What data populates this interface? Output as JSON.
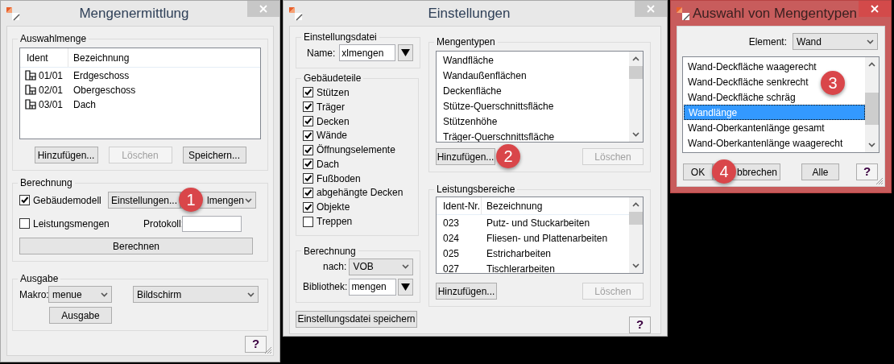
{
  "mengenermittlung": {
    "title": "Mengenermittlung",
    "active": false,
    "auswahlmenge": {
      "label": "Auswahlmenge",
      "columns": [
        "Ident",
        "Bezeichnung"
      ],
      "rows": [
        {
          "ident": "01/01",
          "name": "Erdgeschoss"
        },
        {
          "ident": "02/01",
          "name": "Obergeschoss"
        },
        {
          "ident": "03/01",
          "name": "Dach"
        }
      ],
      "buttons": [
        {
          "label": "Hinzufügen...",
          "disabled": false
        },
        {
          "label": "Löschen",
          "disabled": true
        },
        {
          "label": "Speichern...",
          "disabled": false
        }
      ]
    },
    "berechnung": {
      "label": "Berechnung",
      "checkboxes": [
        {
          "label": "Gebäudemodell",
          "checked": true
        },
        {
          "label": "Leistungsmengen",
          "checked": false
        }
      ],
      "settings_button": "Einstellungen...",
      "settings_select": "lmengen",
      "badge": "1",
      "protokoll_label": "Protokoll:",
      "compute_button": "Berechnen"
    },
    "ausgabe": {
      "label": "Ausgabe",
      "makro_label": "Makro:",
      "makro_select": "menue",
      "target_select": "Bildschirm",
      "button": "Ausgabe"
    },
    "help_button": "?"
  },
  "einstellungen": {
    "title": "Einstellungen",
    "active": false,
    "datei": {
      "label": "Einstellungsdatei",
      "name_label": "Name:",
      "name_value": "xlmengen"
    },
    "gebaeudeteile": {
      "label": "Gebäudeteile",
      "items": [
        {
          "label": "Stützen",
          "checked": true
        },
        {
          "label": "Träger",
          "checked": true
        },
        {
          "label": "Decken",
          "checked": true
        },
        {
          "label": "Wände",
          "checked": true
        },
        {
          "label": "Öffnungselemente",
          "checked": true
        },
        {
          "label": "Dach",
          "checked": true
        },
        {
          "label": "Fußboden",
          "checked": true
        },
        {
          "label": "abgehängte Decken",
          "checked": true
        },
        {
          "label": "Objekte",
          "checked": true
        },
        {
          "label": "Treppen",
          "checked": false
        }
      ]
    },
    "berechnung": {
      "label": "Berechnung",
      "nach_label": "nach:",
      "nach_value": "VOB",
      "bibliothek_label": "Bibliothek:",
      "bibliothek_value": "mengen"
    },
    "save_button": "Einstellungsdatei speichern",
    "mengentypen": {
      "label": "Mengentypen",
      "items": [
        "Wandfläche",
        "Wandaußenflächen",
        "Deckenfläche",
        "Stütze-Querschnittsfläche",
        "Stützenhöhe",
        "Träger-Querschnittsfläche"
      ],
      "buttons": [
        {
          "label": "Hinzufügen...",
          "disabled": false
        },
        {
          "label": "Löschen",
          "disabled": true
        }
      ],
      "badge": "2"
    },
    "leistungsbereiche": {
      "label": "Leistungsbereiche",
      "columns": [
        "Ident-Nr.",
        "Bezeichnung"
      ],
      "rows": [
        {
          "ident": "023",
          "name": "Putz- und Stuckarbeiten"
        },
        {
          "ident": "024",
          "name": "Fliesen- und Plattenarbeiten"
        },
        {
          "ident": "025",
          "name": "Estricharbeiten"
        },
        {
          "ident": "027",
          "name": "Tischlerarbeiten"
        }
      ],
      "buttons": [
        {
          "label": "Hinzufügen...",
          "disabled": false
        },
        {
          "label": "Löschen",
          "disabled": true
        }
      ]
    },
    "help_button": "?"
  },
  "auswahl": {
    "title": "Auswahl von Mengentypen",
    "active": true,
    "element_label": "Element:",
    "element_value": "Wand",
    "badge_list": "3",
    "items": [
      {
        "label": "Wand-Deckfläche waagerecht",
        "selected": false
      },
      {
        "label": "Wand-Deckfläche senkrecht",
        "selected": false
      },
      {
        "label": "Wand-Deckfläche schräg",
        "selected": false
      },
      {
        "label": "Wandlänge",
        "selected": true
      },
      {
        "label": "Wand-Oberkantenlänge gesamt",
        "selected": false
      },
      {
        "label": "Wand-Oberkantenlänge waagerecht",
        "selected": false
      }
    ],
    "ok_button": "OK",
    "cancel_button": "bbrechen",
    "badge_ok": "4",
    "all_button": "Alle",
    "help_button": "?"
  }
}
